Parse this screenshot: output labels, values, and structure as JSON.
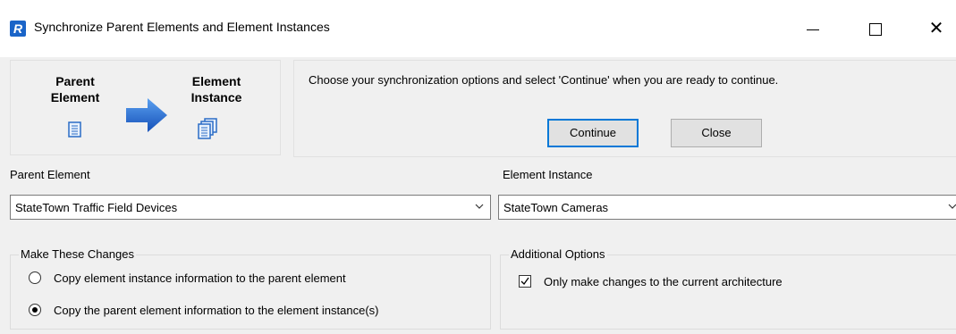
{
  "window": {
    "app_icon_letter": "R",
    "title": "Synchronize Parent Elements and Element Instances",
    "minimize_icon": "minimize-icon",
    "maximize_icon": "maximize-icon",
    "close_glyph": "✕"
  },
  "diagram": {
    "parent_label": "Parent Element",
    "instance_label": "Element Instance",
    "arrow_color": "#1f6fd1"
  },
  "instructions": "Choose your synchronization options and select 'Continue' when you are ready to continue.",
  "buttons": {
    "continue": "Continue",
    "close": "Close"
  },
  "parent_element": {
    "label": "Parent Element",
    "value": "StateTown Traffic Field Devices"
  },
  "element_instance": {
    "label": "Element Instance",
    "value": "StateTown Cameras"
  },
  "make_changes": {
    "title": "Make These Changes",
    "options": [
      {
        "label": "Copy element instance information to the parent element",
        "selected": false
      },
      {
        "label": "Copy the parent element information to the element instance(s)",
        "selected": true
      }
    ]
  },
  "additional_options": {
    "title": "Additional Options",
    "only_current_architecture": {
      "label": "Only make changes to the current architecture",
      "checked": true
    }
  }
}
